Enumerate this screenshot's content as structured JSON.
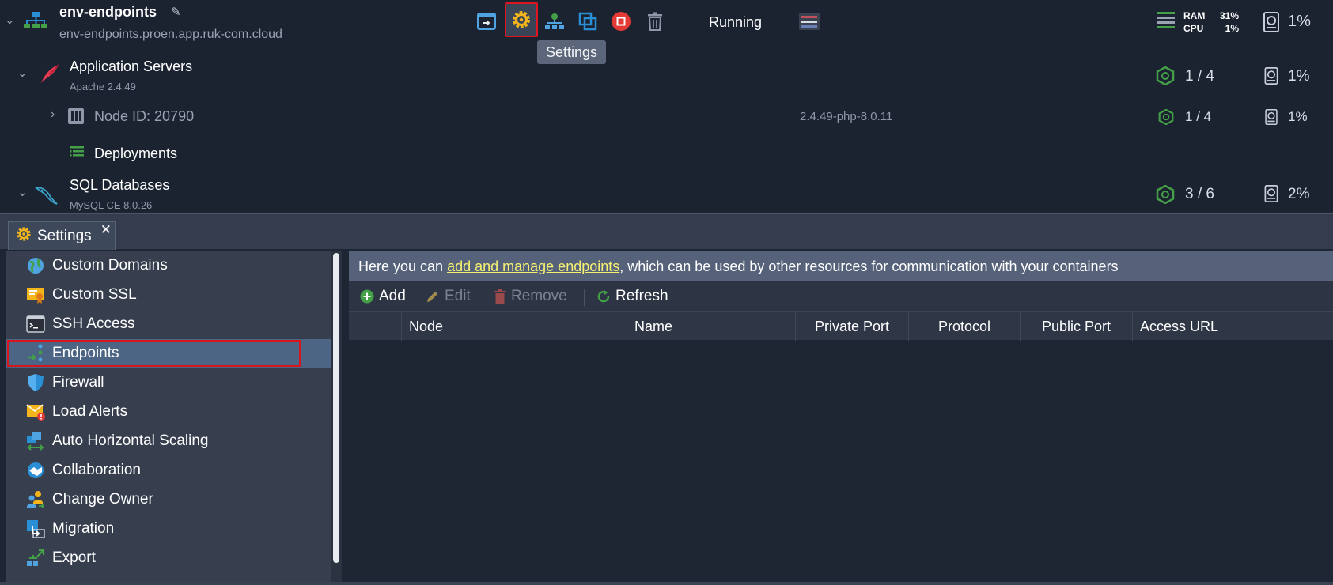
{
  "environment": {
    "name": "env-endpoints",
    "domain": "env-endpoints.proen.app.ruk-com.cloud",
    "status": "Running",
    "ram_label": "RAM",
    "ram_value": "31%",
    "cpu_label": "CPU",
    "cpu_value": "1%",
    "disk_value": "1%",
    "toolbar": {
      "tooltip": "Settings"
    }
  },
  "groups": [
    {
      "name": "Application Servers",
      "version": "Apache 2.4.49",
      "count": "1 / 4",
      "disk": "1%"
    },
    {
      "name": "SQL Databases",
      "version": "MySQL CE 8.0.26",
      "count": "3 / 6",
      "disk": "2%"
    }
  ],
  "node": {
    "label": "Node ID: 20790",
    "tag": "2.4.49-php-8.0.11",
    "count": "1 / 4",
    "disk": "1%"
  },
  "deployments_label": "Deployments",
  "panel": {
    "tab_label": "Settings",
    "sidebar": [
      {
        "label": "Custom Domains",
        "icon": "globe-icon"
      },
      {
        "label": "Custom SSL",
        "icon": "certificate-icon"
      },
      {
        "label": "SSH Access",
        "icon": "terminal-icon"
      },
      {
        "label": "Endpoints",
        "icon": "endpoints-icon",
        "selected": true
      },
      {
        "label": "Firewall",
        "icon": "shield-icon"
      },
      {
        "label": "Load Alerts",
        "icon": "envelope-alert-icon"
      },
      {
        "label": "Auto Horizontal Scaling",
        "icon": "scaling-icon"
      },
      {
        "label": "Collaboration",
        "icon": "handshake-icon"
      },
      {
        "label": "Change Owner",
        "icon": "users-icon"
      },
      {
        "label": "Migration",
        "icon": "migration-icon"
      },
      {
        "label": "Export",
        "icon": "export-icon"
      }
    ],
    "info": {
      "prefix": "Here you can ",
      "link": "add and manage endpoints",
      "suffix": ", which can be used by other resources for communication with your containers"
    },
    "actions": {
      "add": "Add",
      "edit": "Edit",
      "remove": "Remove",
      "refresh": "Refresh"
    },
    "columns": [
      "Node",
      "Name",
      "Private Port",
      "Protocol",
      "Public Port",
      "Access URL"
    ]
  },
  "colors": {
    "accent_red": "#e0141e",
    "link_yellow": "#f6f073",
    "green": "#43a047"
  }
}
